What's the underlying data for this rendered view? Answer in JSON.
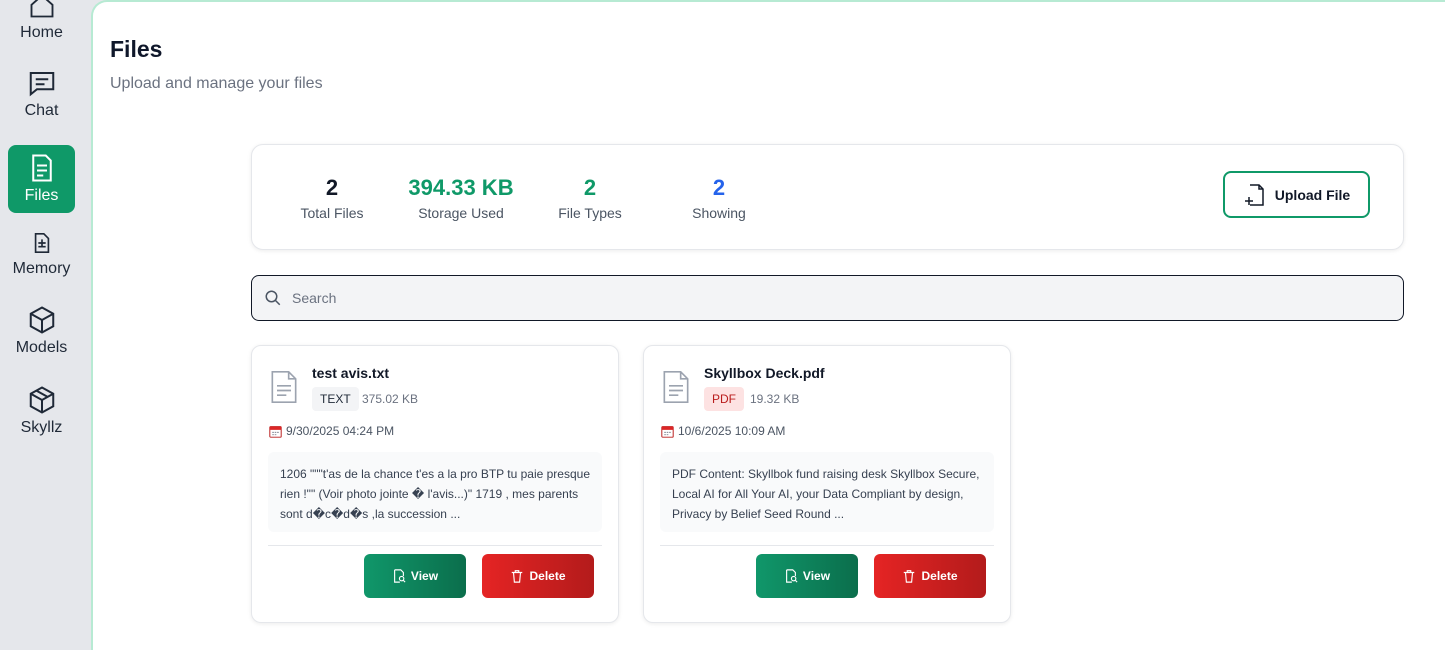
{
  "sidebar": {
    "items": [
      {
        "label": "Home",
        "icon": "home-icon"
      },
      {
        "label": "Chat",
        "icon": "chat-icon"
      },
      {
        "label": "Files",
        "icon": "files-icon",
        "active": true
      },
      {
        "label": "Memory",
        "icon": "memory-icon"
      },
      {
        "label": "Models",
        "icon": "models-icon"
      },
      {
        "label": "Skyllz",
        "icon": "skyllz-icon"
      }
    ]
  },
  "header": {
    "title": "Files",
    "subtitle": "Upload and manage your files"
  },
  "stats": {
    "total_files": {
      "value": "2",
      "label": "Total Files",
      "color": "#111827"
    },
    "storage_used": {
      "value": "394.33 KB",
      "label": "Storage Used",
      "color": "#0f9968"
    },
    "file_types": {
      "value": "2",
      "label": "File Types",
      "color": "#0f9968"
    },
    "showing": {
      "value": "2",
      "label": "Showing",
      "color": "#2563eb"
    }
  },
  "upload_button": {
    "label": "Upload File",
    "icon": "file-plus-icon"
  },
  "search": {
    "placeholder": "Search",
    "value": ""
  },
  "files": [
    {
      "name": "test avis.txt",
      "type": "TEXT",
      "size": "375.02 KB",
      "date": "9/30/2025 04:24 PM",
      "preview": "1206 \"\"\"t'as de la chance t'es a la pro BTP tu paie presque rien !\"\" (Voir photo jointe � l'avis...)\" 1719 , mes parents sont d�c�d�s ,la succession ..."
    },
    {
      "name": "Skyllbox Deck.pdf",
      "type": "PDF",
      "size": "19.32 KB",
      "date": "10/6/2025 10:09 AM",
      "preview": "PDF Content: Skyllbok fund raising desk Skyllbox Secure, Local AI for All Your AI, your Data Compliant by design, Privacy by Belief Seed Round ..."
    }
  ],
  "actions": {
    "view_label": "View",
    "delete_label": "Delete"
  },
  "colors": {
    "accent": "#0f9968",
    "danger": "#dc2626",
    "info": "#2563eb"
  }
}
